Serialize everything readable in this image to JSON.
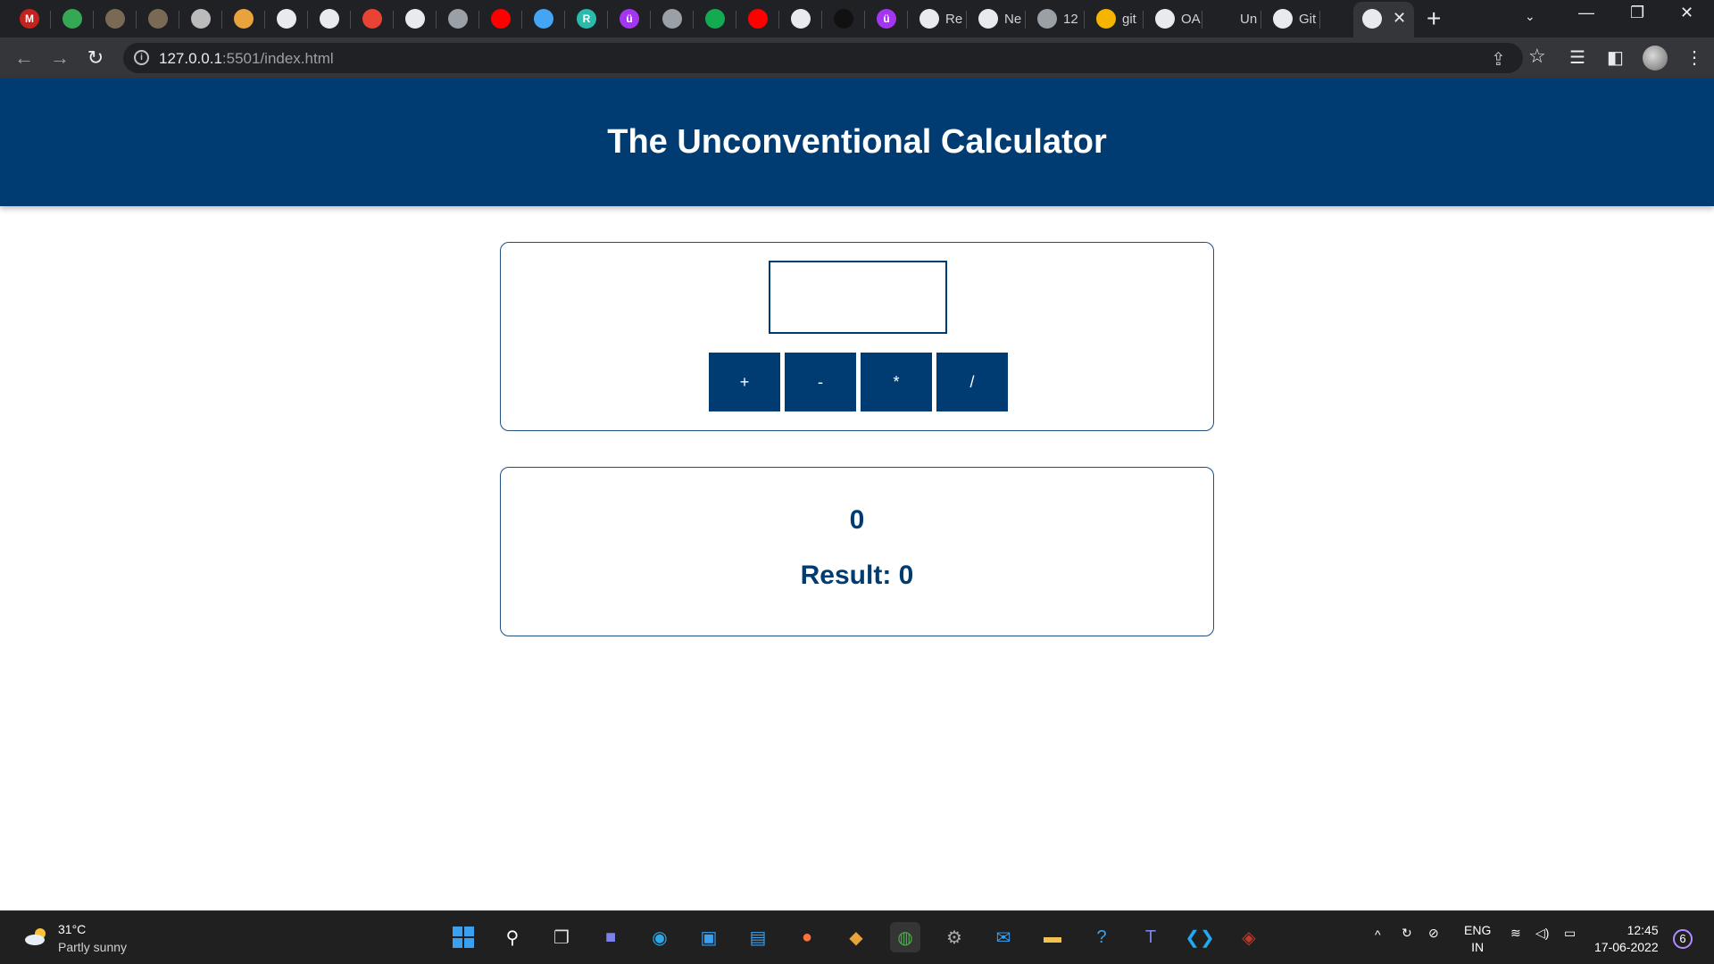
{
  "browser": {
    "tabs": [
      {
        "icon": "gmail-icon",
        "letter": "M",
        "color": "#c5221f",
        "title": ""
      },
      {
        "icon": "sheets-icon",
        "letter": "",
        "color": "#34a853",
        "title": ""
      },
      {
        "icon": "image-icon",
        "letter": "",
        "color": "#7a6a55",
        "title": ""
      },
      {
        "icon": "image-icon",
        "letter": "",
        "color": "#7a6a55",
        "title": ""
      },
      {
        "icon": "page-icon",
        "letter": "",
        "color": "#bbbbbb",
        "title": ""
      },
      {
        "icon": "gear-icon",
        "letter": "",
        "color": "#e8a33d",
        "title": ""
      },
      {
        "icon": "github-icon",
        "letter": "",
        "color": "#e8eaed",
        "title": ""
      },
      {
        "icon": "codepen-icon",
        "letter": "",
        "color": "#e8eaed",
        "title": ""
      },
      {
        "icon": "power-icon",
        "letter": "",
        "color": "#ea4335",
        "title": ""
      },
      {
        "icon": "globe-icon",
        "letter": "",
        "color": "#e8eaed",
        "title": ""
      },
      {
        "icon": "globe-icon",
        "letter": "",
        "color": "#9aa0a6",
        "title": ""
      },
      {
        "icon": "youtube-icon",
        "letter": "",
        "color": "#ff0000",
        "title": ""
      },
      {
        "icon": "flutter-icon",
        "letter": "",
        "color": "#42a5f5",
        "title": ""
      },
      {
        "icon": "r-icon",
        "letter": "R",
        "color": "#2bbbad",
        "title": ""
      },
      {
        "icon": "udemy-icon",
        "letter": "ü",
        "color": "#a435f0",
        "title": ""
      },
      {
        "icon": "globe-icon",
        "letter": "",
        "color": "#9aa0a6",
        "title": ""
      },
      {
        "icon": "mongodb-icon",
        "letter": "",
        "color": "#13aa52",
        "title": ""
      },
      {
        "icon": "youtube-icon",
        "letter": "",
        "color": "#ff0000",
        "title": ""
      },
      {
        "icon": "github-icon",
        "letter": "",
        "color": "#e8eaed",
        "title": ""
      },
      {
        "icon": "mask-icon",
        "letter": "",
        "color": "#111111",
        "title": ""
      },
      {
        "icon": "udemy-icon",
        "letter": "ü",
        "color": "#a435f0",
        "title": ""
      },
      {
        "icon": "github-icon",
        "letter": "",
        "color": "#e8eaed",
        "title": "Re"
      },
      {
        "icon": "chrome-icon",
        "letter": "",
        "color": "#e8eaed",
        "title": "Ne"
      },
      {
        "icon": "globe-icon",
        "letter": "",
        "color": "#9aa0a6",
        "title": "12"
      },
      {
        "icon": "git-icon",
        "letter": "",
        "color": "#f4b400",
        "title": "git"
      },
      {
        "icon": "github-icon",
        "letter": "",
        "color": "#e8eaed",
        "title": "OA"
      },
      {
        "icon": "blank-icon",
        "letter": "",
        "color": "#202124",
        "title": "Un"
      },
      {
        "icon": "globe-icon",
        "letter": "",
        "color": "#e8eaed",
        "title": "Git"
      }
    ],
    "url_host": "127.0.0.1",
    "url_rest": ":5501/index.html"
  },
  "app": {
    "title": "The Unconventional Calculator",
    "input_value": "",
    "operators": [
      "+",
      "-",
      "*",
      "/"
    ],
    "current_value": "0",
    "result_text": "Result: 0"
  },
  "taskbar": {
    "temperature": "31°C",
    "weather": "Partly sunny",
    "lang_line1": "ENG",
    "lang_line2": "IN",
    "time": "12:45",
    "date": "17-06-2022",
    "notifications": "6"
  }
}
